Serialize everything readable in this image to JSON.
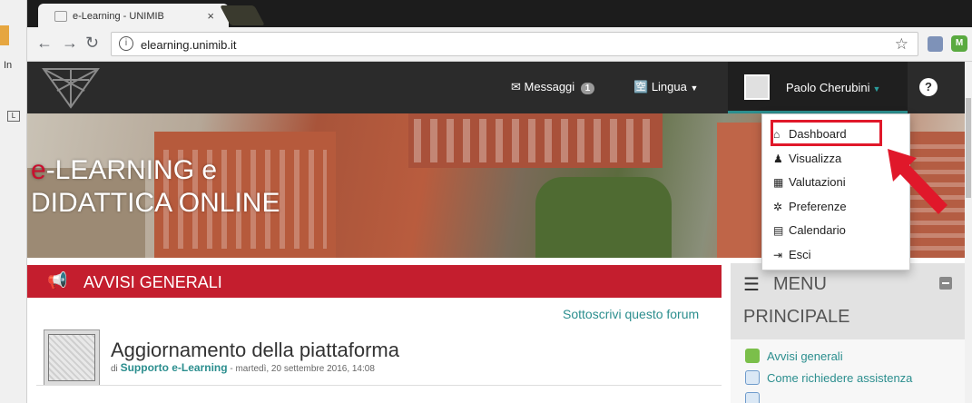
{
  "browser": {
    "tab_title": "e-Learning - UNIMIB",
    "tab_close": "×",
    "url": "elearning.unimib.it",
    "side_text": "In",
    "side_box": "L"
  },
  "navbar": {
    "messages_label": "Messaggi",
    "messages_count": "1",
    "language_label": "Lingua",
    "user_name": "Paolo Cherubini",
    "help": "?"
  },
  "banner": {
    "title_accent": "e",
    "title_line1": "-LEARNING e",
    "title_line2": "DIDATTICA ONLINE"
  },
  "user_menu": {
    "items": [
      {
        "icon": "home-icon",
        "glyph": "⌂",
        "label": "Dashboard"
      },
      {
        "icon": "user-icon",
        "glyph": "♟",
        "label": "Visualizza"
      },
      {
        "icon": "table-icon",
        "glyph": "▦",
        "label": "Valutazioni"
      },
      {
        "icon": "gear-icon",
        "glyph": "✲",
        "label": "Preferenze"
      },
      {
        "icon": "calendar-icon",
        "glyph": "▤",
        "label": "Calendario"
      },
      {
        "icon": "logout-icon",
        "glyph": "⇥",
        "label": "Esci"
      }
    ]
  },
  "forum": {
    "section_title": "AVVISI GENERALI",
    "subscribe_link": "Sottoscrivi questo forum",
    "post_title": "Aggiornamento della piattaforma",
    "post_meta_prefix": "di",
    "post_author": "Supporto e-Learning",
    "post_date": "- martedì, 20 settembre 2016, 14:08"
  },
  "sidebar_menu": {
    "title_line1": "MENU",
    "title_line2": "PRINCIPALE",
    "items": [
      {
        "label": "Avvisi generali"
      },
      {
        "label": "Come richiedere assistenza"
      }
    ]
  },
  "colors": {
    "accent_teal": "#2b8e8e",
    "brand_red": "#c41e2e",
    "highlight_red": "#e0182a"
  }
}
